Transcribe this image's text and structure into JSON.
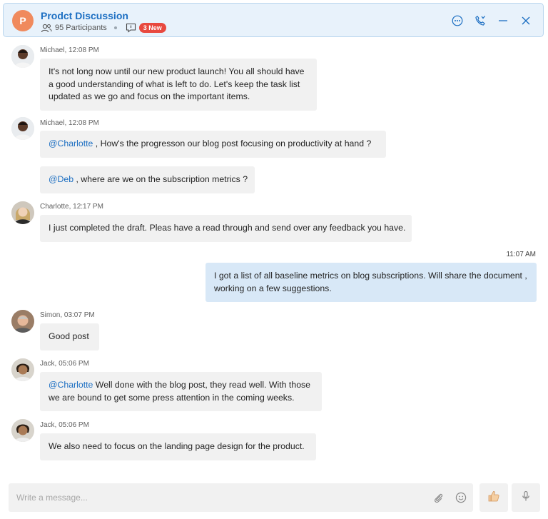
{
  "header": {
    "avatar_letter": "P",
    "title": "Prodct Discussion",
    "participants": "95 Participants",
    "new_badge": "3 New"
  },
  "messages": [
    {
      "meta": "Michael, 12:08 PM",
      "text": "It's not long now until our new product launch! You all should have a good understanding of what is left to do. Let's keep the task list updated as we go and focus on the important items."
    },
    {
      "meta": "Michael, 12:08 PM",
      "mention": "@Charlotte",
      "text": " , How's the progresson our  blog post focusing on productivity at hand ?"
    },
    {
      "mention": "@Deb",
      "text": " , where are we on the subscription metrics ?"
    },
    {
      "meta": "Charlotte, 12:17 PM",
      "text": "I just completed the draft. Pleas have a read through and send over any feedback you have."
    },
    {
      "time": "11:07 AM",
      "text": "I got a list of all baseline metrics on blog subscriptions. Will share the document , working on a few suggestions."
    },
    {
      "meta": "Simon, 03:07 PM",
      "text": "Good post"
    },
    {
      "meta": "Jack, 05:06 PM",
      "mention": "@Charlotte",
      "text": " Well done with the blog post, they read well. With those we are bound to get some press attention in the coming weeks."
    },
    {
      "meta": "Jack, 05:06 PM",
      "text": "We also need to focus on the landing page design for the product."
    }
  ],
  "composer": {
    "placeholder": "Write a message..."
  },
  "icons": {
    "header_actions": [
      "more-icon",
      "call-icon",
      "minimize-icon",
      "close-icon"
    ],
    "composer": [
      "attach-icon",
      "emoji-icon",
      "thumbs-up-icon",
      "microphone-icon"
    ]
  },
  "colors": {
    "accent": "#1b6ec2",
    "header_bg": "#e8f2fb",
    "badge": "#e8493f",
    "outgoing_bubble": "#d8e8f7",
    "incoming_bubble": "#f1f1f1",
    "avatar_header": "#f08a5d"
  }
}
